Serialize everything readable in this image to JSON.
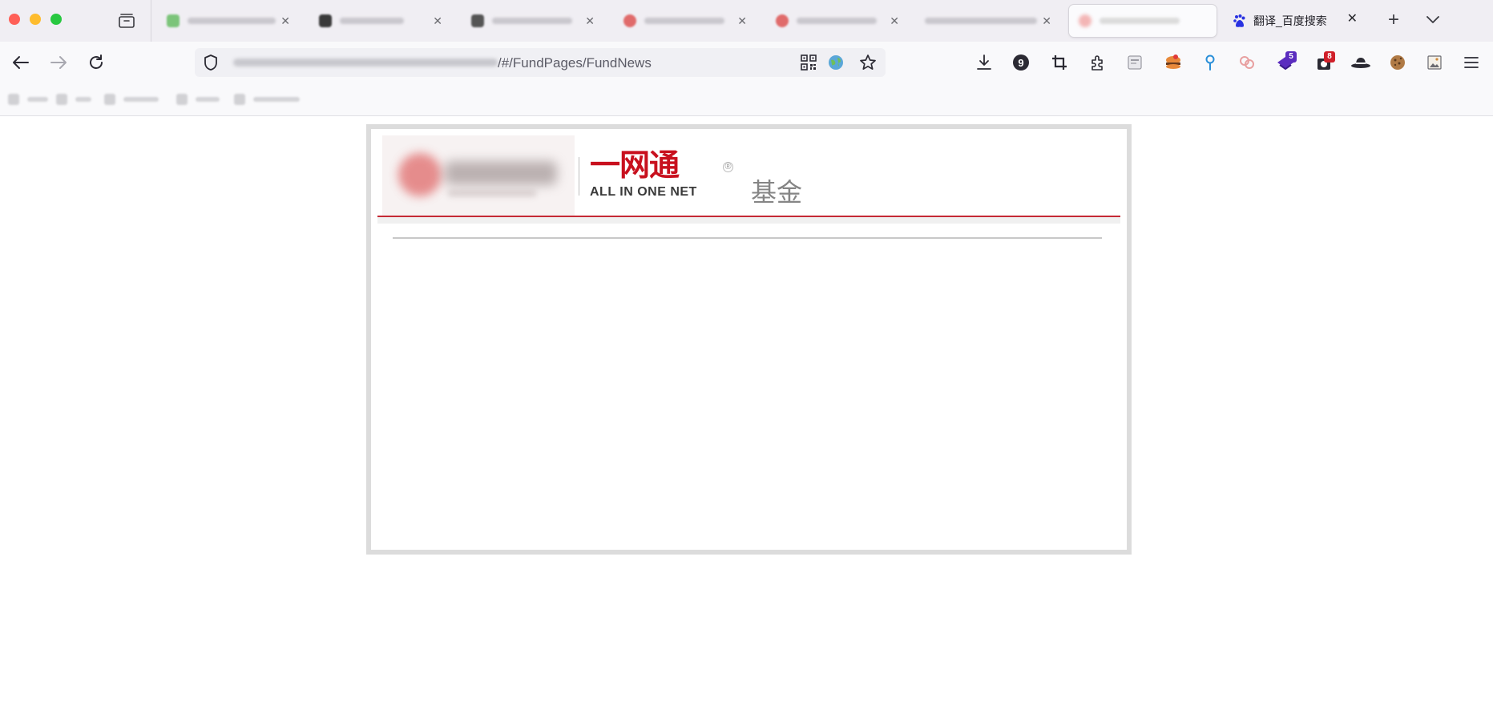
{
  "window": {
    "title": "翻译_百度搜索"
  },
  "tabs": [
    {
      "label": "",
      "active": false
    },
    {
      "label": "",
      "active": false
    },
    {
      "label": "",
      "active": false
    },
    {
      "label": "",
      "active": false
    },
    {
      "label": "",
      "active": false
    },
    {
      "label": "",
      "active": false
    },
    {
      "label": "",
      "active": false
    },
    {
      "label": "翻译_百度搜索",
      "active": true
    }
  ],
  "toolbar": {
    "url_visible": "/#/FundPages/FundNews",
    "downloads_badge": "9",
    "ext_badge_purple": "5",
    "ext_badge_red": "8"
  },
  "bookmarks": [
    {
      "label": ""
    },
    {
      "label": ""
    },
    {
      "label": ""
    },
    {
      "label": ""
    },
    {
      "label": ""
    }
  ],
  "page": {
    "brand_cn": "一网通",
    "brand_en": "ALL IN ONE NET",
    "brand_mark": "®",
    "section_title": "基金"
  },
  "colors": {
    "brand_red": "#c8101e",
    "divider_red": "#c52a35",
    "frame_border": "#dcdcdc"
  },
  "icons": [
    "tab-groups-icon",
    "close-icon",
    "new-tab-icon",
    "tab-list-icon",
    "back-icon",
    "forward-icon",
    "reload-icon",
    "shield-icon",
    "qr-code-icon",
    "globe-icon",
    "bookmark-star-icon",
    "download-icon",
    "crop-icon",
    "extensions-icon",
    "menu-icon"
  ]
}
